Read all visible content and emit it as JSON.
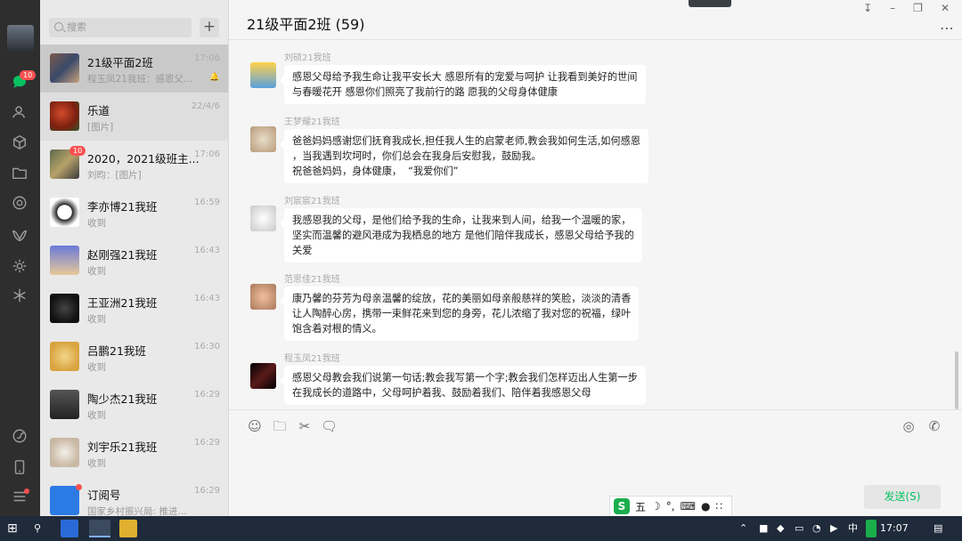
{
  "colors": {
    "accent": "#07c160",
    "badge": "#fa5151",
    "rail": "#2e2e2e",
    "list_bg": "#e9e9e9"
  },
  "rail": {
    "unread_badge": "10"
  },
  "search": {
    "placeholder": "搜索"
  },
  "chats": [
    {
      "name": "21级平面2班",
      "time": "17:06",
      "preview": "程玉凤21我班：感恩父...",
      "selected": true,
      "muted": true
    },
    {
      "name": "乐道",
      "time": "22/4/6",
      "preview": "[图片]"
    },
    {
      "name": "2020，2021级班主...",
      "time": "17:06",
      "preview": "刘昀：[图片]",
      "badge": "10"
    },
    {
      "name": "李亦博21我班",
      "time": "16:59",
      "preview": "收到"
    },
    {
      "name": "赵刚强21我班",
      "time": "16:43",
      "preview": "收到"
    },
    {
      "name": "王亚洲21我班",
      "time": "16:43",
      "preview": "收到"
    },
    {
      "name": "吕鹏21我班",
      "time": "16:30",
      "preview": "收到"
    },
    {
      "name": "陶少杰21我班",
      "time": "16:29",
      "preview": "收到"
    },
    {
      "name": "刘宇乐21我班",
      "time": "16:29",
      "preview": "收到"
    },
    {
      "name": "订阅号",
      "time": "16:29",
      "preview": "国家乡村振兴局: 推进教..."
    }
  ],
  "chat": {
    "title": "21级平面2班 (59)",
    "messages": [
      {
        "sender": "刘硕21我班",
        "text": "感恩父母给予我生命让我平安长大 感恩所有的宠爱与呵护 让我看到美好的世间\n与春暖花开 感恩你们照亮了我前行的路 愿我的父母身体健康"
      },
      {
        "sender": "王梦耀21我班",
        "text": "爸爸妈妈感谢您们抚育我成长,担任我人生的启蒙老师,教会我如何生活,如何感恩\n，当我遇到坎坷时，你们总会在我身后安慰我，鼓励我。\n祝爸爸妈妈，身体健康，  “我爱你们”"
      },
      {
        "sender": "刘宸宸21我班",
        "text": "我感恩我的父母，是他们给予我的生命，让我来到人间，给我一个温暖的家，\n坚实而温馨的避风港成为我栖息的地方 是他们陪伴我成长，感恩父母给予我的\n关爱"
      },
      {
        "sender": "范思佳21我班",
        "text": "康乃馨的芬芳为母亲温馨的绽放，花的美丽如母亲般慈祥的笑脸，淡淡的清香\n让人陶醉心房，携带一束鲜花来到您的身旁，花儿浓缩了我对您的祝福，绿叶\n饱含着对根的情义。"
      },
      {
        "sender": "程玉凤21我班",
        "text": "感恩父母教会我们说第一句话;教会我写第一个字;教会我们怎样迈出人生第一步\n在我成长的道路中，父母呵护着我、鼓励着我们、陪伴着我感恩父母"
      }
    ],
    "send_label": "发送(S)"
  },
  "ime": {
    "logo": "S",
    "mode": "五",
    "punct": "°,"
  },
  "taskbar": {
    "lang": "中",
    "time": "17:07"
  }
}
